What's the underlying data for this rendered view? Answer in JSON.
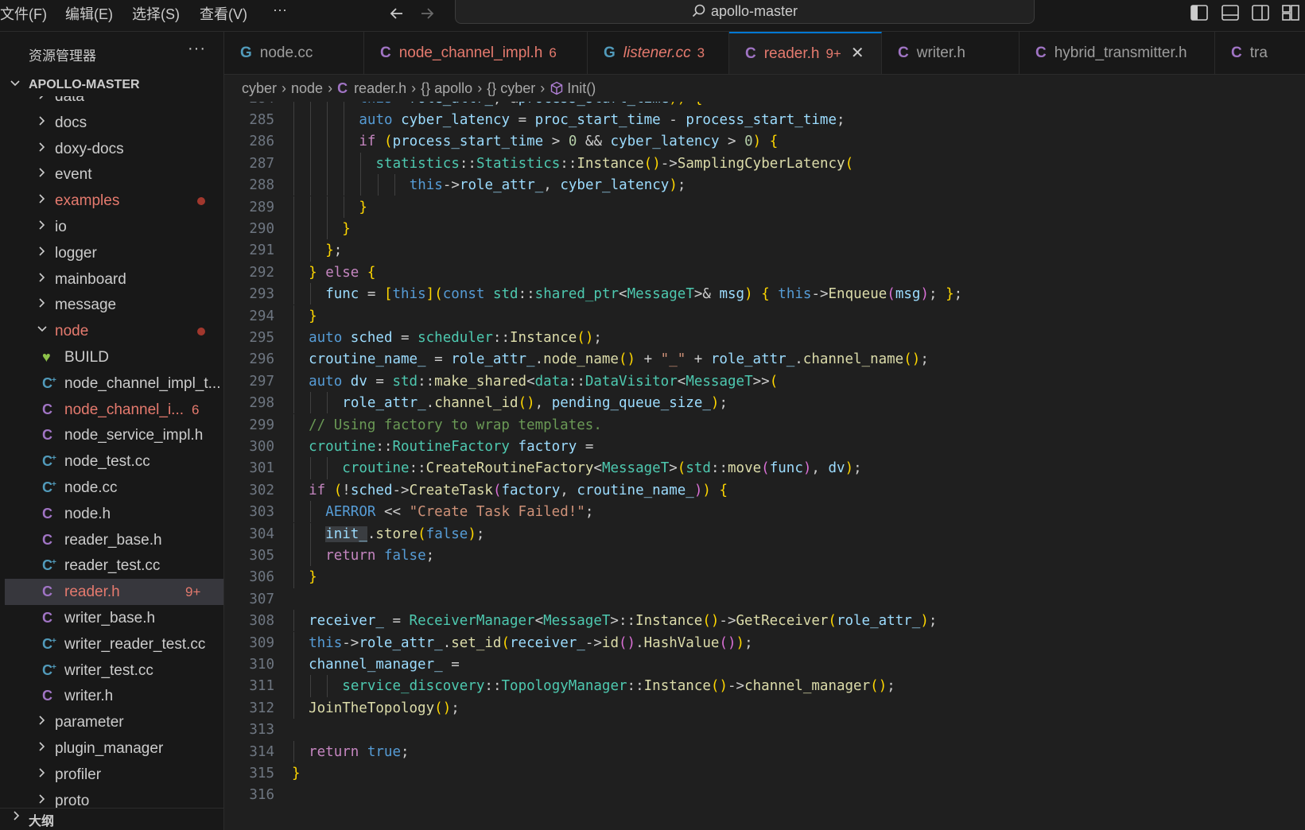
{
  "menu": {
    "file": "文件(F)",
    "edit": "编辑(E)",
    "select": "选择(S)",
    "view": "查看(V)",
    "more": "···"
  },
  "command_center": {
    "text": "apollo-master"
  },
  "sidebar": {
    "title": "资源管理器",
    "more": "···",
    "root": "APOLLO-MASTER",
    "outline": "大纲",
    "items": [
      {
        "label": "data",
        "type": "folder"
      },
      {
        "label": "docs",
        "type": "folder"
      },
      {
        "label": "doxy-docs",
        "type": "folder"
      },
      {
        "label": "event",
        "type": "folder"
      },
      {
        "label": "examples",
        "type": "folder",
        "status": "modified"
      },
      {
        "label": "io",
        "type": "folder"
      },
      {
        "label": "logger",
        "type": "folder"
      },
      {
        "label": "mainboard",
        "type": "folder"
      },
      {
        "label": "message",
        "type": "folder"
      },
      {
        "label": "node",
        "type": "folder-open",
        "status": "modified"
      },
      {
        "label": "BUILD",
        "type": "build"
      },
      {
        "label": "node_channel_impl_t...",
        "type": "cc"
      },
      {
        "label": "node_channel_i...",
        "type": "h",
        "badge": "6",
        "status": "error"
      },
      {
        "label": "node_service_impl.h",
        "type": "h"
      },
      {
        "label": "node_test.cc",
        "type": "cc"
      },
      {
        "label": "node.cc",
        "type": "cc"
      },
      {
        "label": "node.h",
        "type": "h"
      },
      {
        "label": "reader_base.h",
        "type": "h"
      },
      {
        "label": "reader_test.cc",
        "type": "cc"
      },
      {
        "label": "reader.h",
        "type": "h",
        "badge": "9+",
        "status": "error",
        "selected": true
      },
      {
        "label": "writer_base.h",
        "type": "h"
      },
      {
        "label": "writer_reader_test.cc",
        "type": "cc"
      },
      {
        "label": "writer_test.cc",
        "type": "cc"
      },
      {
        "label": "writer.h",
        "type": "h"
      },
      {
        "label": "parameter",
        "type": "folder"
      },
      {
        "label": "plugin_manager",
        "type": "folder"
      },
      {
        "label": "profiler",
        "type": "folder"
      },
      {
        "label": "proto",
        "type": "folder"
      }
    ]
  },
  "tabs": [
    {
      "label": "node.cc",
      "type": "cc",
      "count": ""
    },
    {
      "label": "node_channel_impl.h",
      "type": "h",
      "count": "6"
    },
    {
      "label": "listener.cc",
      "type": "cc",
      "count": "3"
    },
    {
      "label": "reader.h",
      "type": "h",
      "count": "9+",
      "active": true
    },
    {
      "label": "writer.h",
      "type": "h",
      "count": ""
    },
    {
      "label": "hybrid_transmitter.h",
      "type": "h",
      "count": ""
    },
    {
      "label": "tra",
      "type": "h",
      "count": ""
    }
  ],
  "breadcrumb": [
    "cyber",
    "node",
    "reader.h",
    "{} apollo",
    "{} cyber",
    "Init()"
  ],
  "icons": {
    "cc": "C-plus-icon",
    "h": "C-icon",
    "build": "heart-icon",
    "function": "cube-icon"
  },
  "colors": {
    "accent": "#0078d4",
    "error": "#f14c4c",
    "keyword": "#569cd6",
    "type": "#4ec9b0",
    "function": "#dcdcaa",
    "variable": "#9cdcfe",
    "string": "#ce9178",
    "comment": "#6a9955"
  },
  "editor": {
    "lines": [
      {
        "n": "284",
        "text": "this->role_attr_, &process_start_time)) {"
      },
      {
        "n": "285",
        "text": "auto cyber_latency = proc_start_time - process_start_time;"
      },
      {
        "n": "286",
        "text": "if (process_start_time > 0 && cyber_latency > 0) {"
      },
      {
        "n": "287",
        "text": "statistics::Statistics::Instance()->SamplingCyberLatency("
      },
      {
        "n": "288",
        "text": "this->role_attr_, cyber_latency);"
      },
      {
        "n": "289",
        "text": "}"
      },
      {
        "n": "290",
        "text": "}"
      },
      {
        "n": "291",
        "text": "};"
      },
      {
        "n": "292",
        "text": "} else {"
      },
      {
        "n": "293",
        "text": "func = [this](const std::shared_ptr<MessageT>& msg) { this->Enqueue(msg); };"
      },
      {
        "n": "294",
        "text": "}"
      },
      {
        "n": "295",
        "text": "auto sched = scheduler::Instance();"
      },
      {
        "n": "296",
        "text": "croutine_name_ = role_attr_.node_name() + \"_\" + role_attr_.channel_name();"
      },
      {
        "n": "297",
        "text": "auto dv = std::make_shared<data::DataVisitor<MessageT>>("
      },
      {
        "n": "298",
        "text": "role_attr_.channel_id(), pending_queue_size_);"
      },
      {
        "n": "299",
        "text": "// Using factory to wrap templates."
      },
      {
        "n": "300",
        "text": "croutine::RoutineFactory factory ="
      },
      {
        "n": "301",
        "text": "croutine::CreateRoutineFactory<MessageT>(std::move(func), dv);"
      },
      {
        "n": "302",
        "text": "if (!sched->CreateTask(factory, croutine_name_)) {"
      },
      {
        "n": "303",
        "text": "AERROR << \"Create Task Failed!\";"
      },
      {
        "n": "304",
        "text": "init_.store(false);"
      },
      {
        "n": "305",
        "text": "return false;"
      },
      {
        "n": "306",
        "text": "}"
      },
      {
        "n": "307",
        "text": ""
      },
      {
        "n": "308",
        "text": "receiver_ = ReceiverManager<MessageT>::Instance()->GetReceiver(role_attr_);"
      },
      {
        "n": "309",
        "text": "this->role_attr_.set_id(receiver_->id().HashValue());"
      },
      {
        "n": "310",
        "text": "channel_manager_ ="
      },
      {
        "n": "311",
        "text": "service_discovery::TopologyManager::Instance()->channel_manager();"
      },
      {
        "n": "312",
        "text": "JoinTheTopology();"
      },
      {
        "n": "313",
        "text": ""
      },
      {
        "n": "314",
        "text": "return true;"
      },
      {
        "n": "315",
        "text": "}"
      },
      {
        "n": "316",
        "text": ""
      }
    ]
  }
}
